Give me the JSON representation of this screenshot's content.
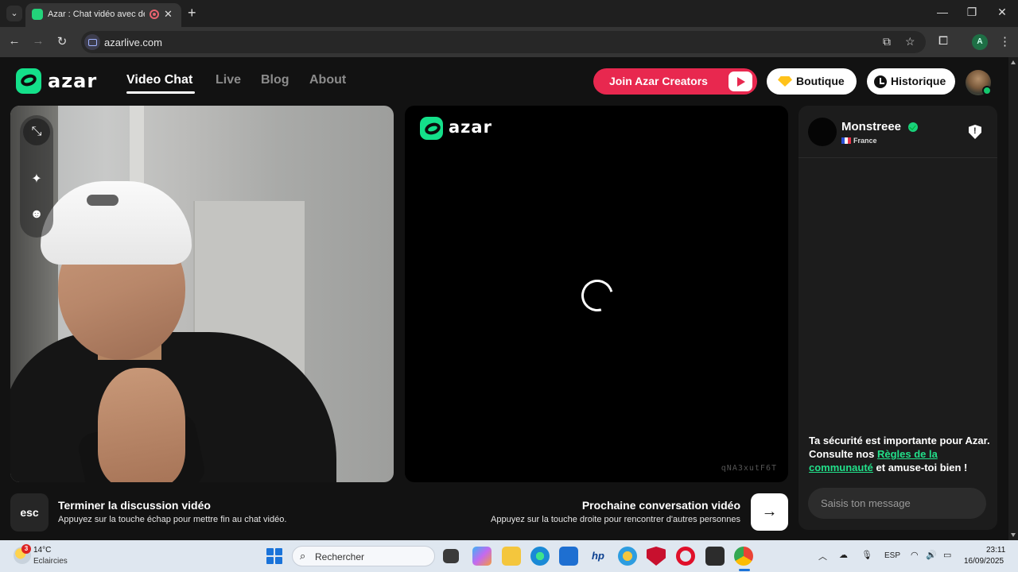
{
  "browser": {
    "tab_title": "Azar : Chat vidéo avec de n",
    "url": "azarlive.com",
    "profile_initial": "A"
  },
  "header": {
    "logo_text": "azar",
    "nav": [
      "Video Chat",
      "Live",
      "Blog",
      "About"
    ],
    "active_nav": "Video Chat",
    "creators_label": "Join Azar Creators",
    "boutique_label": "Boutique",
    "history_label": "Historique"
  },
  "partner_video": {
    "logo_text": "azar",
    "session_id": "qNA3xutF6T",
    "state": "loading"
  },
  "chat": {
    "peer_name": "Monstreee",
    "peer_country": "France",
    "safety_text_1": "Ta sécurité est importante pour Azar. Consulte nos ",
    "safety_link": "Règles de la communauté",
    "safety_text_2": " et amuse-toi bien !",
    "input_placeholder": "Saisis ton message"
  },
  "bottom": {
    "esc_key": "esc",
    "end_title": "Terminer la discussion vidéo",
    "end_hint": "Appuyez sur la touche échap pour mettre fin au chat vidéo.",
    "next_title": "Prochaine conversation vidéo",
    "next_hint": "Appuyez sur la touche droite pour rencontrer d'autres personnes",
    "next_key": "→"
  },
  "taskbar": {
    "weather_badge": "3",
    "weather_temp": "14°C",
    "weather_desc": "Eclaircies",
    "search_placeholder": "Rechercher",
    "language": "ESP",
    "time": "23:11",
    "date": "16/09/2025"
  },
  "colors": {
    "brand_green": "#14e08a",
    "creators_red": "#e8284f",
    "page_bg": "#121212"
  }
}
